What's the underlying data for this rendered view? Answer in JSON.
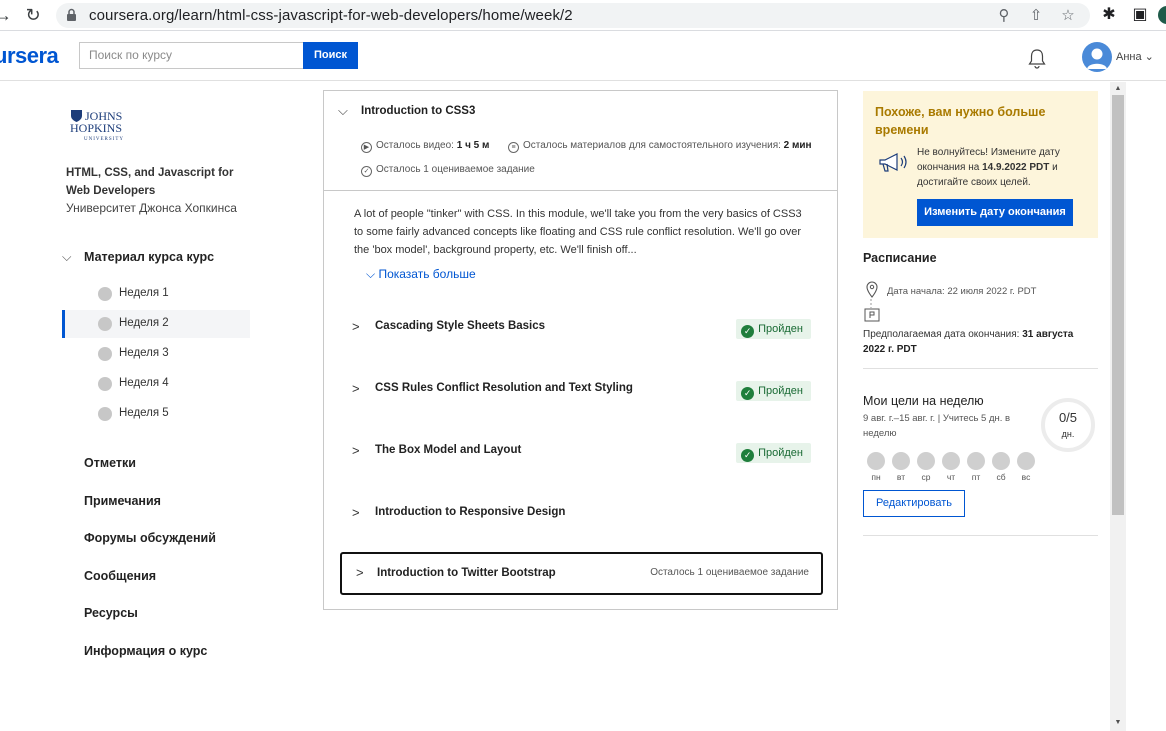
{
  "browser": {
    "url": "coursera.org/learn/html-css-javascript-for-web-developers/home/week/2"
  },
  "header": {
    "logo": "ursera",
    "search_placeholder": "Поиск по курсу",
    "search_button": "Поиск",
    "user_name": "Анна"
  },
  "sidebar": {
    "university_logo_lines": [
      "JOHNS",
      "HOPKINS",
      "UNIVERSITY"
    ],
    "course_title": "HTML, CSS, and Javascript for Web Developers",
    "university": "Университет Джонса Хопкинса",
    "material_label": "Материал курса курс",
    "weeks": [
      "Неделя 1",
      "Неделя 2",
      "Неделя 3",
      "Неделя 4",
      "Неделя 5"
    ],
    "active_week_index": 1,
    "links": [
      "Отметки",
      "Примечания",
      "Форумы обсуждений",
      "Сообщения",
      "Ресурсы",
      "Информация о курс"
    ]
  },
  "module": {
    "title": "Introduction to CSS3",
    "videos_left_label": "Осталось видео:",
    "videos_left_value": "1 ч 5 м",
    "materials_left_label": "Осталось материалов для самостоятельного изучения:",
    "materials_left_value": "2 мин",
    "graded_left": "Осталось 1 оцениваемое задание",
    "description": "A lot of people \"tinker\" with CSS. In this module, we'll take you from the very basics of CSS3 to some fairly advanced concepts like floating and CSS rule conflict resolution. We'll go over the 'box model', background property, etc. We'll finish off...",
    "show_more": "Показать больше",
    "lessons": [
      {
        "name": "Cascading Style Sheets Basics",
        "status": "Пройден"
      },
      {
        "name": "CSS Rules Conflict Resolution and Text Styling",
        "status": "Пройден"
      },
      {
        "name": "The Box Model and Layout",
        "status": "Пройден"
      },
      {
        "name": "Introduction to Responsive Design",
        "status": ""
      },
      {
        "name": "Introduction to Twitter Bootstrap",
        "status": "Осталось 1 оцениваемое задание"
      }
    ]
  },
  "deadline": {
    "title": "Похоже, вам нужно больше времени",
    "text_before": "Не волнуйтесь! Измените дату окончания на",
    "new_date": "14.9.2022 PDT",
    "text_after": "и достигайте своих целей.",
    "button": "Изменить дату окончания"
  },
  "schedule": {
    "title": "Расписание",
    "start": "Дата начала: 22 июля 2022 г. PDT",
    "end_label": "Предполагаемая дата окончания:",
    "end_value": "31 августа 2022 г. PDT"
  },
  "goals": {
    "title": "Мои цели на неделю",
    "subtitle": "9 авг. г.–15 авг. г. | Учитесь 5 дн. в неделю",
    "progress_value": "0/5",
    "progress_unit": "дн.",
    "days": [
      "пн",
      "вт",
      "ср",
      "чт",
      "пт",
      "сб",
      "вс"
    ],
    "edit_button": "Редактировать"
  },
  "colors": {
    "brand_blue": "#0056d2",
    "completed_green": "#1f7e3c",
    "deadline_bg": "#fdf5db",
    "deadline_title": "#a97a00"
  }
}
